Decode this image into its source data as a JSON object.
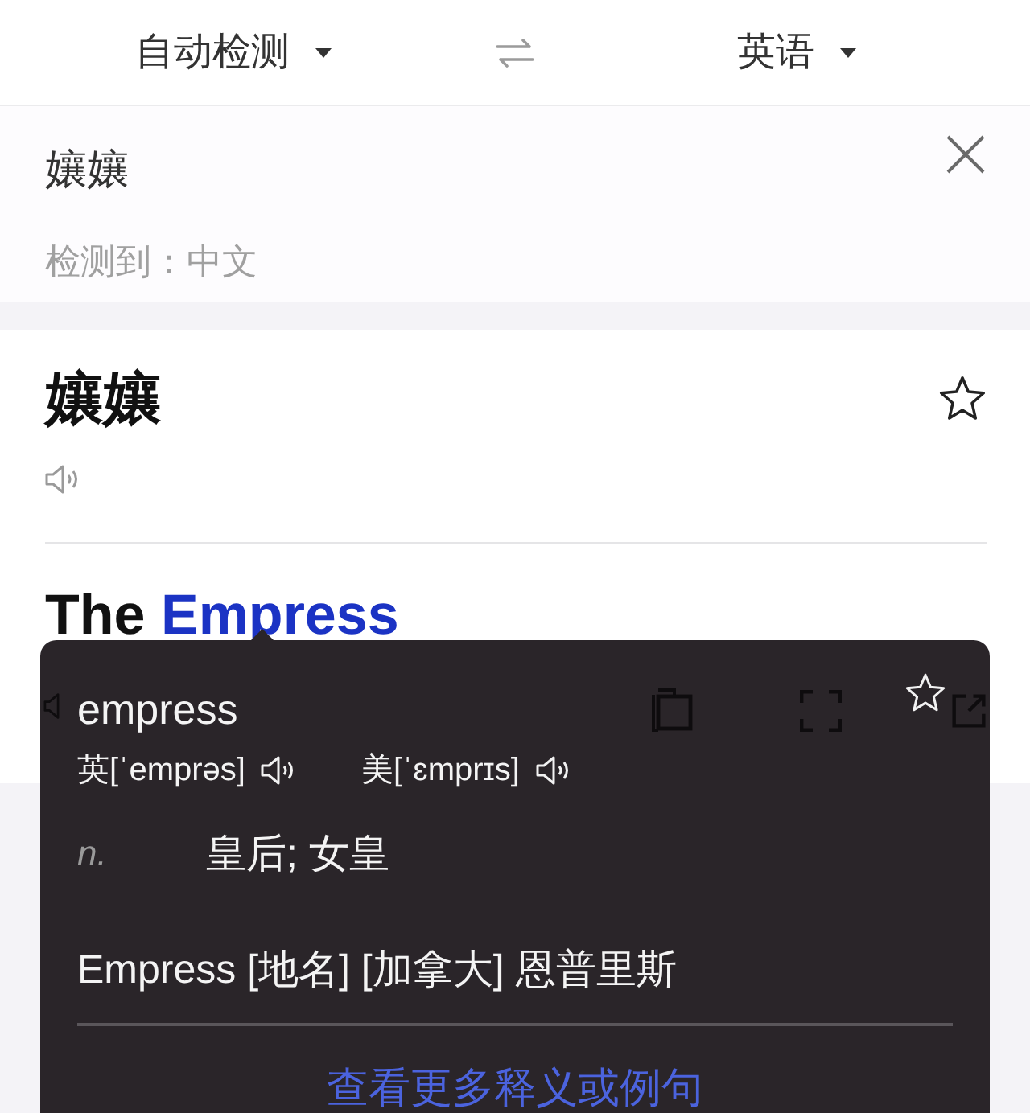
{
  "language_bar": {
    "source_language": "自动检测",
    "target_language": "英语"
  },
  "input": {
    "value": "孃孃",
    "detected_language": "检测到：中文"
  },
  "result": {
    "word": "孃孃",
    "starred": false,
    "translation_words": [
      {
        "text": "The",
        "selected": false
      },
      {
        "text": "Empress",
        "selected": true
      }
    ]
  },
  "popup": {
    "headword": "empress",
    "starred": false,
    "pronunciations": [
      {
        "label": "英[ˈemprəs]"
      },
      {
        "label": "美[ˈɛmprɪs]"
      }
    ],
    "senses": [
      {
        "pos": "n.",
        "meaning": "皇后; 女皇"
      }
    ],
    "proper_noun": "Empress [地名] [加拿大] 恩普里斯",
    "more_link": "查看更多释义或例句"
  }
}
